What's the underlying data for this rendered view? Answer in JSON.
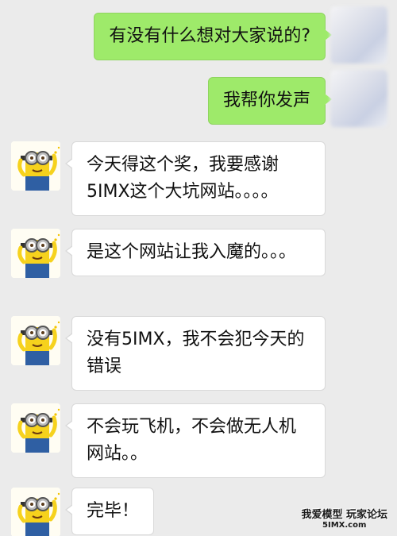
{
  "messages": [
    {
      "from": "me",
      "text": "有没有什么想对大家说的?"
    },
    {
      "from": "me",
      "text": "我帮你发声"
    },
    {
      "from": "minion",
      "text": "今天得这个奖，我要感谢5IMX这个大坑网站。。。。"
    },
    {
      "from": "minion",
      "text": "是这个网站让我入魔的。。。"
    },
    {
      "from": "minion",
      "text": "没有5IMX，我不会犯今天的错误"
    },
    {
      "from": "minion",
      "text": "不会玩飞机，不会做无人机网站。。"
    },
    {
      "from": "minion",
      "text": "完毕！"
    }
  ],
  "watermark": {
    "line1": "我爱模型 玩家论坛",
    "line2": "5IMX.com"
  },
  "colors": {
    "background": "#ebebeb",
    "outgoing_bubble": "#9eea6a",
    "incoming_bubble": "#ffffff"
  }
}
